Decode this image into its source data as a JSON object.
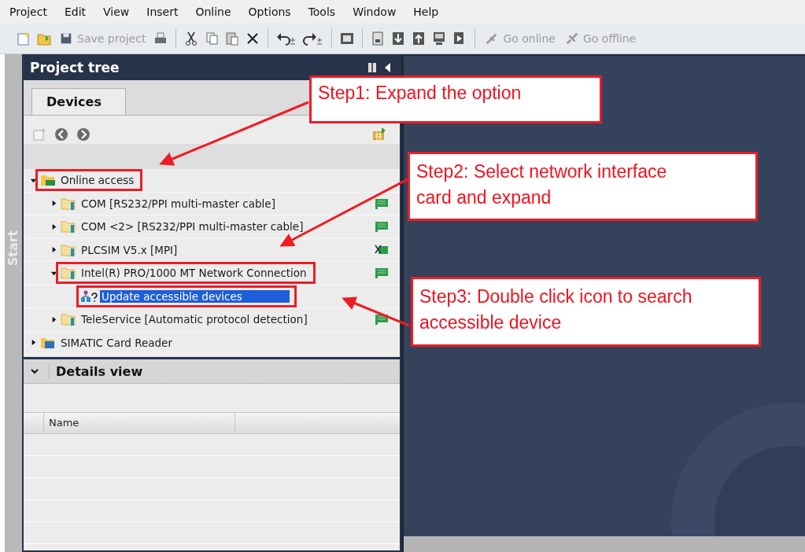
{
  "menu": [
    "Project",
    "Edit",
    "View",
    "Insert",
    "Online",
    "Options",
    "Tools",
    "Window",
    "Help"
  ],
  "toolbar": [
    {
      "label": "Save project",
      "disabled": true
    },
    {
      "label": "Go online",
      "disabled": true
    },
    {
      "label": "Go offline",
      "disabled": true
    }
  ],
  "side_tab": {
    "label": "Start"
  },
  "project_tree": {
    "title": "Project tree",
    "tabs": [
      {
        "label": "Devices",
        "selected": true
      }
    ],
    "tree": [
      {
        "label": "Online access",
        "kind": "access",
        "expanded": true,
        "highlighted": true,
        "children": [
          {
            "label": "COM [RS232/PPI multi-master cable]",
            "kind": "interface",
            "expanded": false,
            "highlighted": false
          },
          {
            "label": "COM <2> [RS232/PPI multi-master cable]",
            "kind": "interface",
            "expanded": false,
            "highlighted": false
          },
          {
            "label": "PLCSIM V5.x [MPI]",
            "kind": "simulator",
            "expanded": false,
            "highlighted": false
          },
          {
            "label": "Intel(R) PRO/1000 MT Network Connection",
            "kind": "interface",
            "expanded": true,
            "highlighted": true,
            "children": [
              {
                "label": "Update accessible devices",
                "kind": "action",
                "selected": true,
                "highlighted": true
              }
            ]
          },
          {
            "label": "TeleService [Automatic protocol detection]",
            "kind": "interface",
            "expanded": false,
            "highlighted": false
          }
        ]
      },
      {
        "label": "SIMATIC Card Reader",
        "kind": "reader",
        "expanded": false,
        "highlighted": false
      }
    ]
  },
  "details_view": {
    "title": "Details view",
    "expanded": true,
    "columns": [
      "Name"
    ]
  },
  "annotations": [
    {
      "text": "Step1: Expand the option"
    },
    {
      "text": "Step2: Select network interface card and expand"
    },
    {
      "text": "Step3: Double click icon to search accessible device"
    }
  ]
}
